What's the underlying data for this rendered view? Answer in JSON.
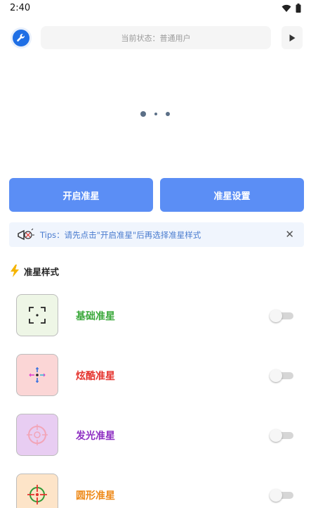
{
  "status_bar": {
    "time": "2:40"
  },
  "header": {
    "status_text": "当前状态：普通用户"
  },
  "actions": {
    "start_label": "开启准星",
    "settings_label": "准星设置"
  },
  "tips": {
    "text": "Tips：请先点击\"开启准星\"后再选择准星样式",
    "close_glyph": "✕"
  },
  "section": {
    "title": "准星样式"
  },
  "styles": [
    {
      "label": "基础准星",
      "label_color": "#3aa83a",
      "bg": "#eef6e6",
      "icon": "basic-crosshair-icon",
      "enabled": false
    },
    {
      "label": "炫酷准星",
      "label_color": "#e5342e",
      "bg": "#fbd6d6",
      "icon": "cool-crosshair-icon",
      "enabled": false
    },
    {
      "label": "发光准星",
      "label_color": "#8e2fc2",
      "bg": "#e8cdf2",
      "icon": "glow-crosshair-icon",
      "enabled": false
    },
    {
      "label": "圆形准星",
      "label_color": "#ee8a1a",
      "bg": "#fde4c8",
      "icon": "circle-crosshair-icon",
      "enabled": false
    }
  ],
  "colors": {
    "accent": "#5b8ef5",
    "tip_text": "#4a7ccf",
    "tool_blue": "#1f6fe5"
  }
}
